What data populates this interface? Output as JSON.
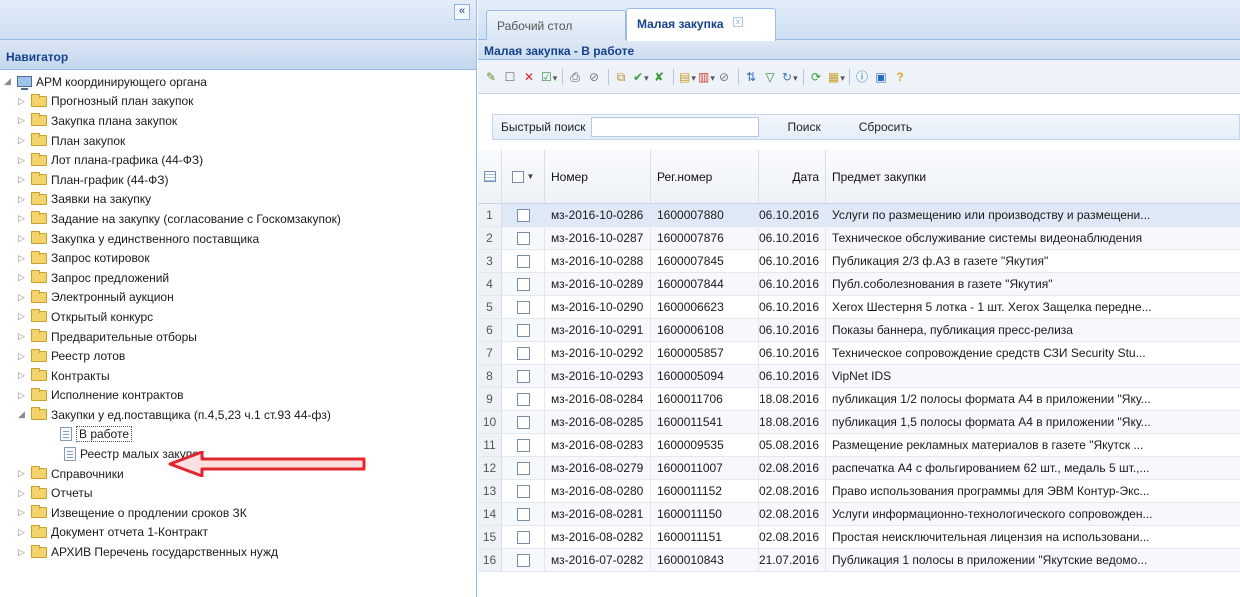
{
  "navigator": {
    "title": "Навигатор",
    "collapse_label": "«",
    "root": "АРМ координирующего органа",
    "items": [
      "Прогнозный план закупок",
      "Закупка плана закупок",
      "План закупок",
      "Лот плана-графика (44-ФЗ)",
      "План-график (44-ФЗ)",
      "Заявки на закупку",
      "Задание на закупку (согласование с Госкомзакупок)",
      "Закупка у единственного поставщика",
      "Запрос котировок",
      "Запрос предложений",
      "Электронный аукцион",
      "Открытый конкурс",
      "Предварительные отборы",
      "Реестр лотов",
      "Контракты",
      "Исполнение контрактов"
    ],
    "expanded": {
      "label": "Закупки у ед.поставщика (п.4,5,23 ч.1 ст.93 44-фз)",
      "children": [
        "В работе",
        "Реестр малых закупок"
      ]
    },
    "items_after": [
      "Справочники",
      "Отчеты",
      "Извещение о продлении сроков ЗК",
      "Документ отчета 1-Контракт",
      "АРХИВ Перечень государственных нужд"
    ]
  },
  "tabs": {
    "desk": "Рабочий стол",
    "small": "Малая закупка",
    "close": "x"
  },
  "panel": {
    "title": "Малая закупка - В работе"
  },
  "search": {
    "label": "Быстрый поиск",
    "value": "",
    "search_button": "Поиск",
    "reset_button": "Сбросить"
  },
  "grid": {
    "columns": [
      "Номер",
      "Рег.номер",
      "Дата",
      "Предмет закупки"
    ],
    "rows": [
      {
        "n": "1",
        "no": "мз-2016-10-0286",
        "reg": "1600007880",
        "date": "06.10.2016",
        "subj": "Услуги по размещению или производству и размещени..."
      },
      {
        "n": "2",
        "no": "мз-2016-10-0287",
        "reg": "1600007876",
        "date": "06.10.2016",
        "subj": "Техническое обслуживание системы видеонаблюдения"
      },
      {
        "n": "3",
        "no": "мз-2016-10-0288",
        "reg": "1600007845",
        "date": "06.10.2016",
        "subj": "Публикация 2/3 ф.А3 в газете \"Якутия\""
      },
      {
        "n": "4",
        "no": "мз-2016-10-0289",
        "reg": "1600007844",
        "date": "06.10.2016",
        "subj": "Публ.соболезнования в газете \"Якутия\""
      },
      {
        "n": "5",
        "no": "мз-2016-10-0290",
        "reg": "1600006623",
        "date": "06.10.2016",
        "subj": "Xerox Шестерня 5 лотка - 1 шт. Xerox Защелка передне..."
      },
      {
        "n": "6",
        "no": "мз-2016-10-0291",
        "reg": "1600006108",
        "date": "06.10.2016",
        "subj": "Показы баннера, публикация пресс-релиза"
      },
      {
        "n": "7",
        "no": "мз-2016-10-0292",
        "reg": "1600005857",
        "date": "06.10.2016",
        "subj": "Техническое сопровождение средств СЗИ Security Stu..."
      },
      {
        "n": "8",
        "no": "мз-2016-10-0293",
        "reg": "1600005094",
        "date": "06.10.2016",
        "subj": "VipNet IDS"
      },
      {
        "n": "9",
        "no": "мз-2016-08-0284",
        "reg": "1600011706",
        "date": "18.08.2016",
        "subj": "публикация 1/2 полосы формата А4 в приложении \"Яку..."
      },
      {
        "n": "10",
        "no": "мз-2016-08-0285",
        "reg": "1600011541",
        "date": "18.08.2016",
        "subj": "публикация 1,5 полосы формата А4 в приложении \"Яку..."
      },
      {
        "n": "11",
        "no": "мз-2016-08-0283",
        "reg": "1600009535",
        "date": "05.08.2016",
        "subj": "Размещение рекламных материалов в газете \"Якутск ..."
      },
      {
        "n": "12",
        "no": "мз-2016-08-0279",
        "reg": "1600011007",
        "date": "02.08.2016",
        "subj": "распечатка А4 с фольгированием 62 шт., медаль 5 шт.,..."
      },
      {
        "n": "13",
        "no": "мз-2016-08-0280",
        "reg": "1600011152",
        "date": "02.08.2016",
        "subj": "Право использования программы для ЭВМ Контур-Экс..."
      },
      {
        "n": "14",
        "no": "мз-2016-08-0281",
        "reg": "1600011150",
        "date": "02.08.2016",
        "subj": "Услуги информационно-технологического сопровожден..."
      },
      {
        "n": "15",
        "no": "мз-2016-08-0282",
        "reg": "1600011151",
        "date": "02.08.2016",
        "subj": "Простая неисключительная лицензия на использовани..."
      },
      {
        "n": "16",
        "no": "мз-2016-07-0282",
        "reg": "1600010843",
        "date": "21.07.2016",
        "subj": "Публикация 1 полосы в приложении \"Якутские ведомо..."
      }
    ]
  },
  "colors": {
    "header_blue": "#15428b",
    "border_blue": "#99bbe8",
    "arrow_red": "#e3262e",
    "folder_yellow": "#f3d36c"
  }
}
